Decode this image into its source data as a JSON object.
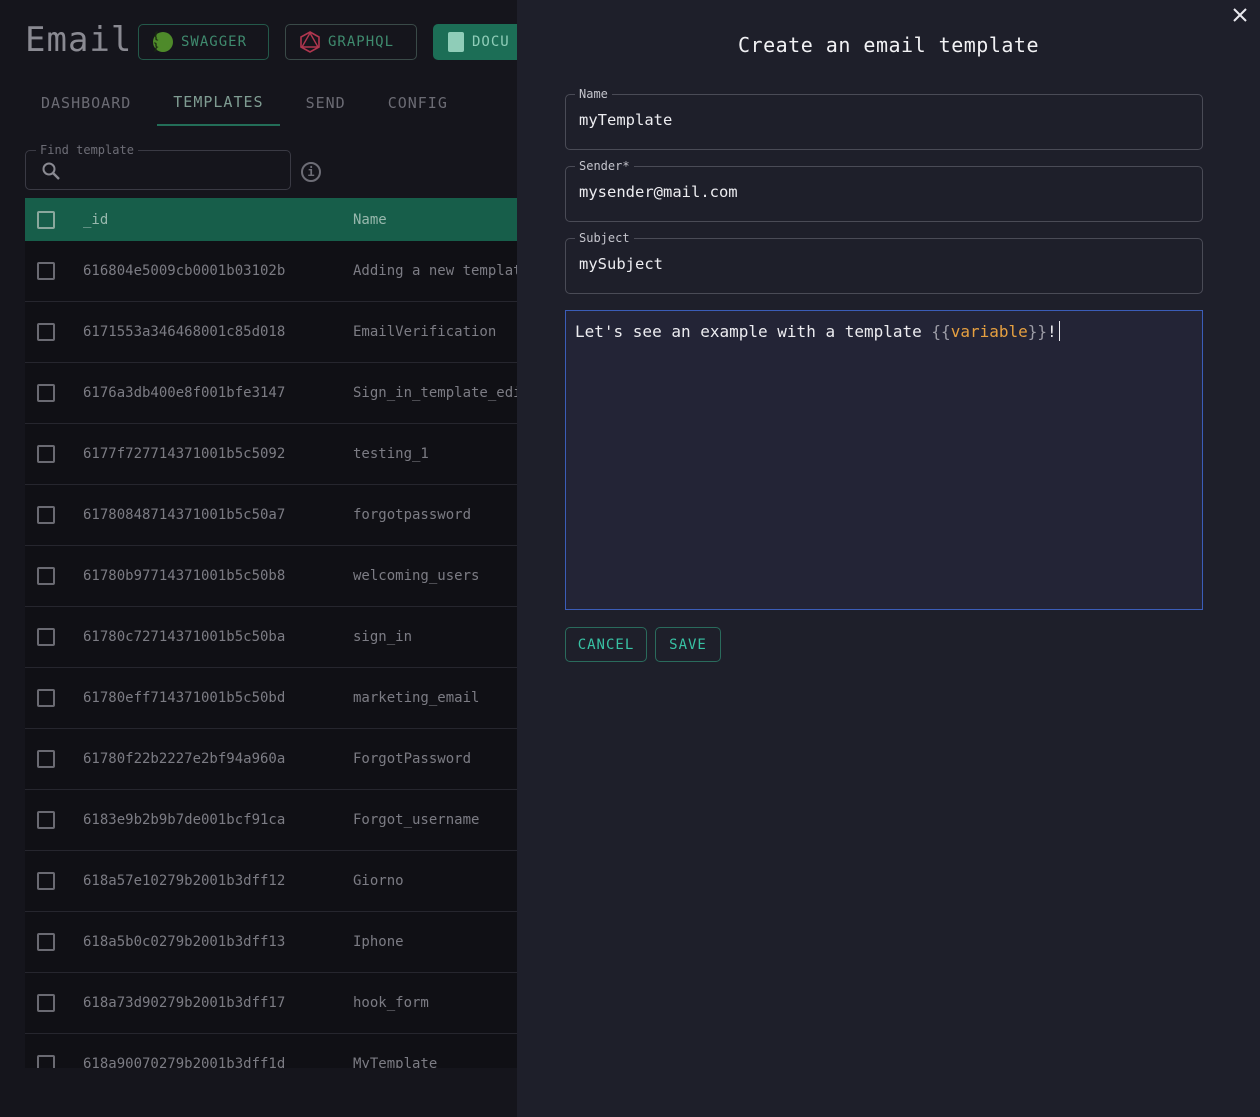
{
  "app": {
    "title": "Email"
  },
  "header_buttons": {
    "swagger": "SWAGGER",
    "graphql": "GRAPHQL",
    "docs": "DOCU"
  },
  "tabs": [
    "DASHBOARD",
    "TEMPLATES",
    "SEND",
    "CONFIG"
  ],
  "active_tab": "TEMPLATES",
  "search": {
    "label": "Find template",
    "value": ""
  },
  "table": {
    "columns": {
      "id": "_id",
      "name": "Name"
    },
    "rows": [
      {
        "id": "616804e5009cb0001b03102b",
        "name": "Adding a new templat"
      },
      {
        "id": "6171553a346468001c85d018",
        "name": "EmailVerification"
      },
      {
        "id": "6176a3db400e8f001bfe3147",
        "name": "Sign_in_template_edi"
      },
      {
        "id": "6177f727714371001b5c5092",
        "name": "testing_1"
      },
      {
        "id": "61780848714371001b5c50a7",
        "name": "forgotpassword"
      },
      {
        "id": "61780b97714371001b5c50b8",
        "name": "welcoming_users"
      },
      {
        "id": "61780c72714371001b5c50ba",
        "name": "sign_in"
      },
      {
        "id": "61780eff714371001b5c50bd",
        "name": "marketing_email"
      },
      {
        "id": "61780f22b2227e2bf94a960a",
        "name": "ForgotPassword"
      },
      {
        "id": "6183e9b2b9b7de001bcf91ca",
        "name": "Forgot_username"
      },
      {
        "id": "618a57e10279b2001b3dff12",
        "name": "Giorno"
      },
      {
        "id": "618a5b0c0279b2001b3dff13",
        "name": "Iphone"
      },
      {
        "id": "618a73d90279b2001b3dff17",
        "name": "hook_form"
      },
      {
        "id": "618a90070279b2001b3dff1d",
        "name": "MyTemplate"
      }
    ]
  },
  "drawer": {
    "title": "Create an email template",
    "name": {
      "label": "Name",
      "value": "myTemplate"
    },
    "sender": {
      "label": "Sender*",
      "value": "mysender@mail.com"
    },
    "subject": {
      "label": "Subject",
      "value": "mySubject"
    },
    "body": {
      "prefix": "Let's see an example with a template ",
      "open_brace": "{{",
      "variable": "variable",
      "close_brace": "}}",
      "suffix": "!"
    },
    "cancel_label": "CANCEL",
    "save_label": "SAVE"
  },
  "colors": {
    "accent": "#38c2a4",
    "table_header": "#175e4a",
    "drawer_bg": "#1e1f2a",
    "variable_highlight": "#e6a040",
    "editor_focus_border": "#3b5db8"
  },
  "icons": {
    "close": "close-icon",
    "search": "search-icon",
    "info": "info-icon",
    "swagger": "swagger-icon",
    "graphql": "graphql-icon",
    "docs": "document-icon"
  }
}
